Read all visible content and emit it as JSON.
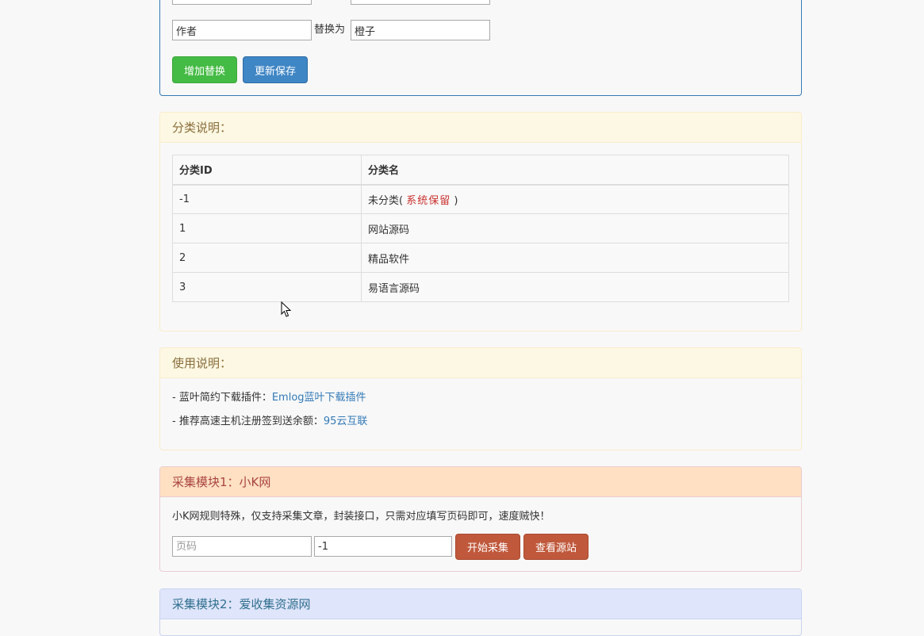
{
  "replace": {
    "row_label": "替换为",
    "find_value": "作者",
    "replace_value": "橙子",
    "add_button": "增加替换",
    "save_button": "更新保存"
  },
  "categories": {
    "heading": "分类说明：",
    "columns": [
      "分类ID",
      "分类名"
    ],
    "rows": [
      {
        "id": "-1",
        "name": "未分类(",
        "note": "系统保留",
        "close": ")"
      },
      {
        "id": "1",
        "name": "网站源码"
      },
      {
        "id": "2",
        "name": "精品软件"
      },
      {
        "id": "3",
        "name": "易语言源码"
      }
    ]
  },
  "usage": {
    "heading": "使用说明：",
    "lines": [
      {
        "prefix": "- 蓝叶简约下载插件：",
        "link": "Emlog蓝叶下载插件"
      },
      {
        "prefix": "- 推荐高速主机注册签到送余额：",
        "link": "95云互联"
      }
    ]
  },
  "module1": {
    "heading": "采集模块1：小K网",
    "description": "小K网规则特殊，仅支持采集文章，封装接口，只需对应填写页码即可，速度贼快！",
    "page_placeholder": "页码",
    "category_value": "-1",
    "start_button": "开始采集",
    "view_button": "查看源站"
  },
  "module2": {
    "heading": "采集模块2：爱收集资源网"
  },
  "colors": {
    "warning_bg": "#fcf8e3",
    "danger_bg": "#f2dede",
    "info_bg": "#d9edf7",
    "primary_border": "#337ab7"
  }
}
